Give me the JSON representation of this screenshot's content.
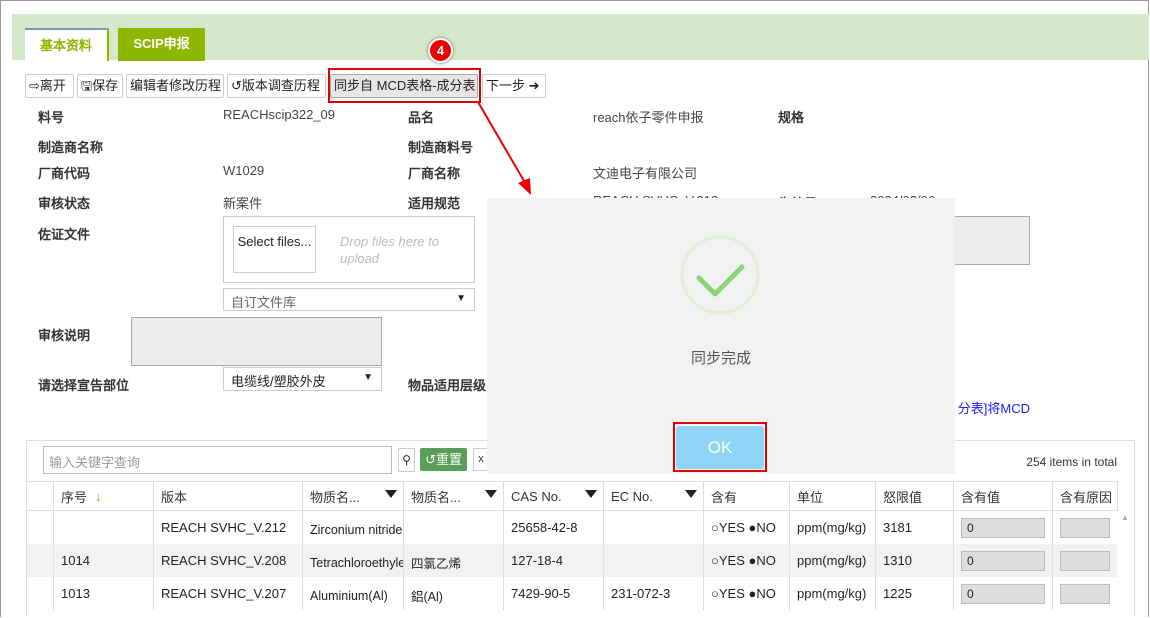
{
  "tabs": [
    "基本资料",
    "SCIP申报"
  ],
  "toolbar": {
    "leave": "离开",
    "save": "保存",
    "editor_history": "编辑者修改历程",
    "version_history": "版本调查历程",
    "sync": "同步自 MCD表格-成分表",
    "next": "下一步"
  },
  "step_badge": "4",
  "form": {
    "part_no_label": "料号",
    "part_no": "REACHscip322_09",
    "name_label": "品名",
    "name": "reach依子零件申报",
    "spec_label": "规格",
    "mfr_name_label": "制造商名称",
    "mfr_part_label": "制造商料号",
    "vendor_code_label": "厂商代码",
    "vendor_code": "W1029",
    "vendor_name_label": "厂商名称",
    "vendor_name": "文迪电子有限公司",
    "review_status_label": "审核状态",
    "review_status": "新案件",
    "regulation_label": "适用规范",
    "regulation": "REACH SVHC_V.212",
    "effective_label": "生效日",
    "effective": "2024/03/06",
    "evidence_label": "佐证文件",
    "select_files": "Select files...",
    "drop_hint": "Drop files here to upload",
    "library_select": "自订文件库",
    "review_note_label": "审核说明",
    "part_select_label": "请选择宣告部位",
    "part_select": "电缆线/塑胶外皮",
    "level_label": "物品适用层级",
    "link_text": "分表]将MCD"
  },
  "dialog": {
    "message": "同步完成",
    "ok": "OK",
    "icon": "check-circle",
    "icon_color": "#8ed27a"
  },
  "grid": {
    "search_placeholder": "输入关键字查询",
    "reset": "重置",
    "total": "254 items in total",
    "columns": [
      "",
      "序号",
      "版本",
      "物质名...",
      "物质名...",
      "CAS No.",
      "EC No.",
      "含有",
      "单位",
      "怒限值",
      "含有值",
      "含有原因"
    ],
    "rows": [
      {
        "no": "",
        "version": "REACH SVHC_V.212",
        "name_en": "Zirconium nitride",
        "name_cn": "",
        "cas": "25658-42-8",
        "ec": "",
        "yes": "YES",
        "no_opt": "NO",
        "unit": "ppm(mg/kg)",
        "limit": "3181",
        "value": "0"
      },
      {
        "no": "1014",
        "version": "REACH SVHC_V.208",
        "name_en": "Tetrachloroethylene",
        "name_cn": "四氯乙烯",
        "cas": "127-18-4",
        "ec": "",
        "yes": "YES",
        "no_opt": "NO",
        "unit": "ppm(mg/kg)",
        "limit": "1310",
        "value": "0"
      },
      {
        "no": "1013",
        "version": "REACH SVHC_V.207",
        "name_en": "Aluminium(Al)",
        "name_cn": "鋁(Al)",
        "cas": "7429-90-5",
        "ec": "231-072-3",
        "yes": "YES",
        "no_opt": "NO",
        "unit": "ppm(mg/kg)",
        "limit": "1225",
        "value": "0"
      }
    ]
  },
  "colors": {
    "tab_green": "#8db600",
    "band": "#d5e8cc",
    "ok": "#8dd4f5",
    "highlight": "#e00000",
    "reset": "#5a9e5a"
  }
}
